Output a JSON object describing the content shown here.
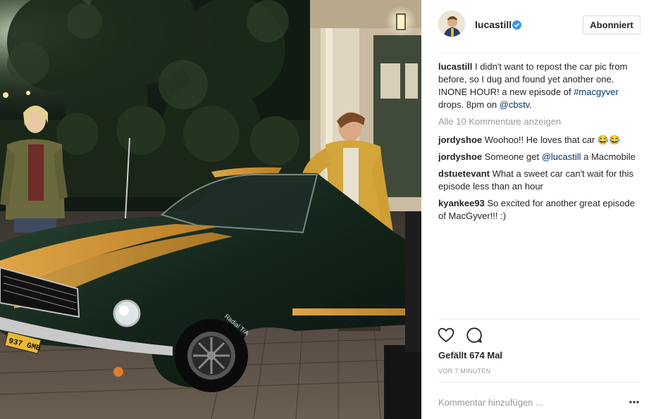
{
  "post": {
    "username": "lucastill",
    "follow_label": "Abonniert",
    "caption_parts": {
      "user": "lucastill",
      "text1": " I didn't want to repost the car pic from before, so I dug and found yet another one. INONE HOUR! a new episode of ",
      "hashtag": "#macgyver",
      "text2": " drops. 8pm on ",
      "mention": "@cbstv",
      "text3": "."
    },
    "view_all_comments": "Alle 10 Kommentare anzeigen",
    "comments": [
      {
        "user": "jordyshoe",
        "text": " Woohoo!! He loves that car 😂😂"
      },
      {
        "user": "jordyshoe",
        "text_before": " Someone get ",
        "mention": "@lucastill",
        "text_after": " a Macmobile"
      },
      {
        "user": "dstuetevant",
        "text": " What a sweet car can't wait for this episode less than an hour"
      },
      {
        "user": "kyankee93",
        "text": " So excited for another great episode of MacGyver!!! :)"
      }
    ],
    "likes": "Gefällt 674 Mal",
    "timestamp": "VOR 7 MINUTEN",
    "comment_placeholder": "Kommentar hinzufügen ...",
    "more_label": "•••"
  },
  "photo": {
    "license_plate": "937 GMB",
    "tire_text": "Radial T/A"
  },
  "icons": {
    "like": "heart-icon",
    "comment": "comment-bubble-icon",
    "verified": "verified-badge-icon",
    "more": "more-options-icon"
  },
  "colors": {
    "verified": "#3897f0",
    "link": "#003569",
    "muted": "#999999"
  }
}
